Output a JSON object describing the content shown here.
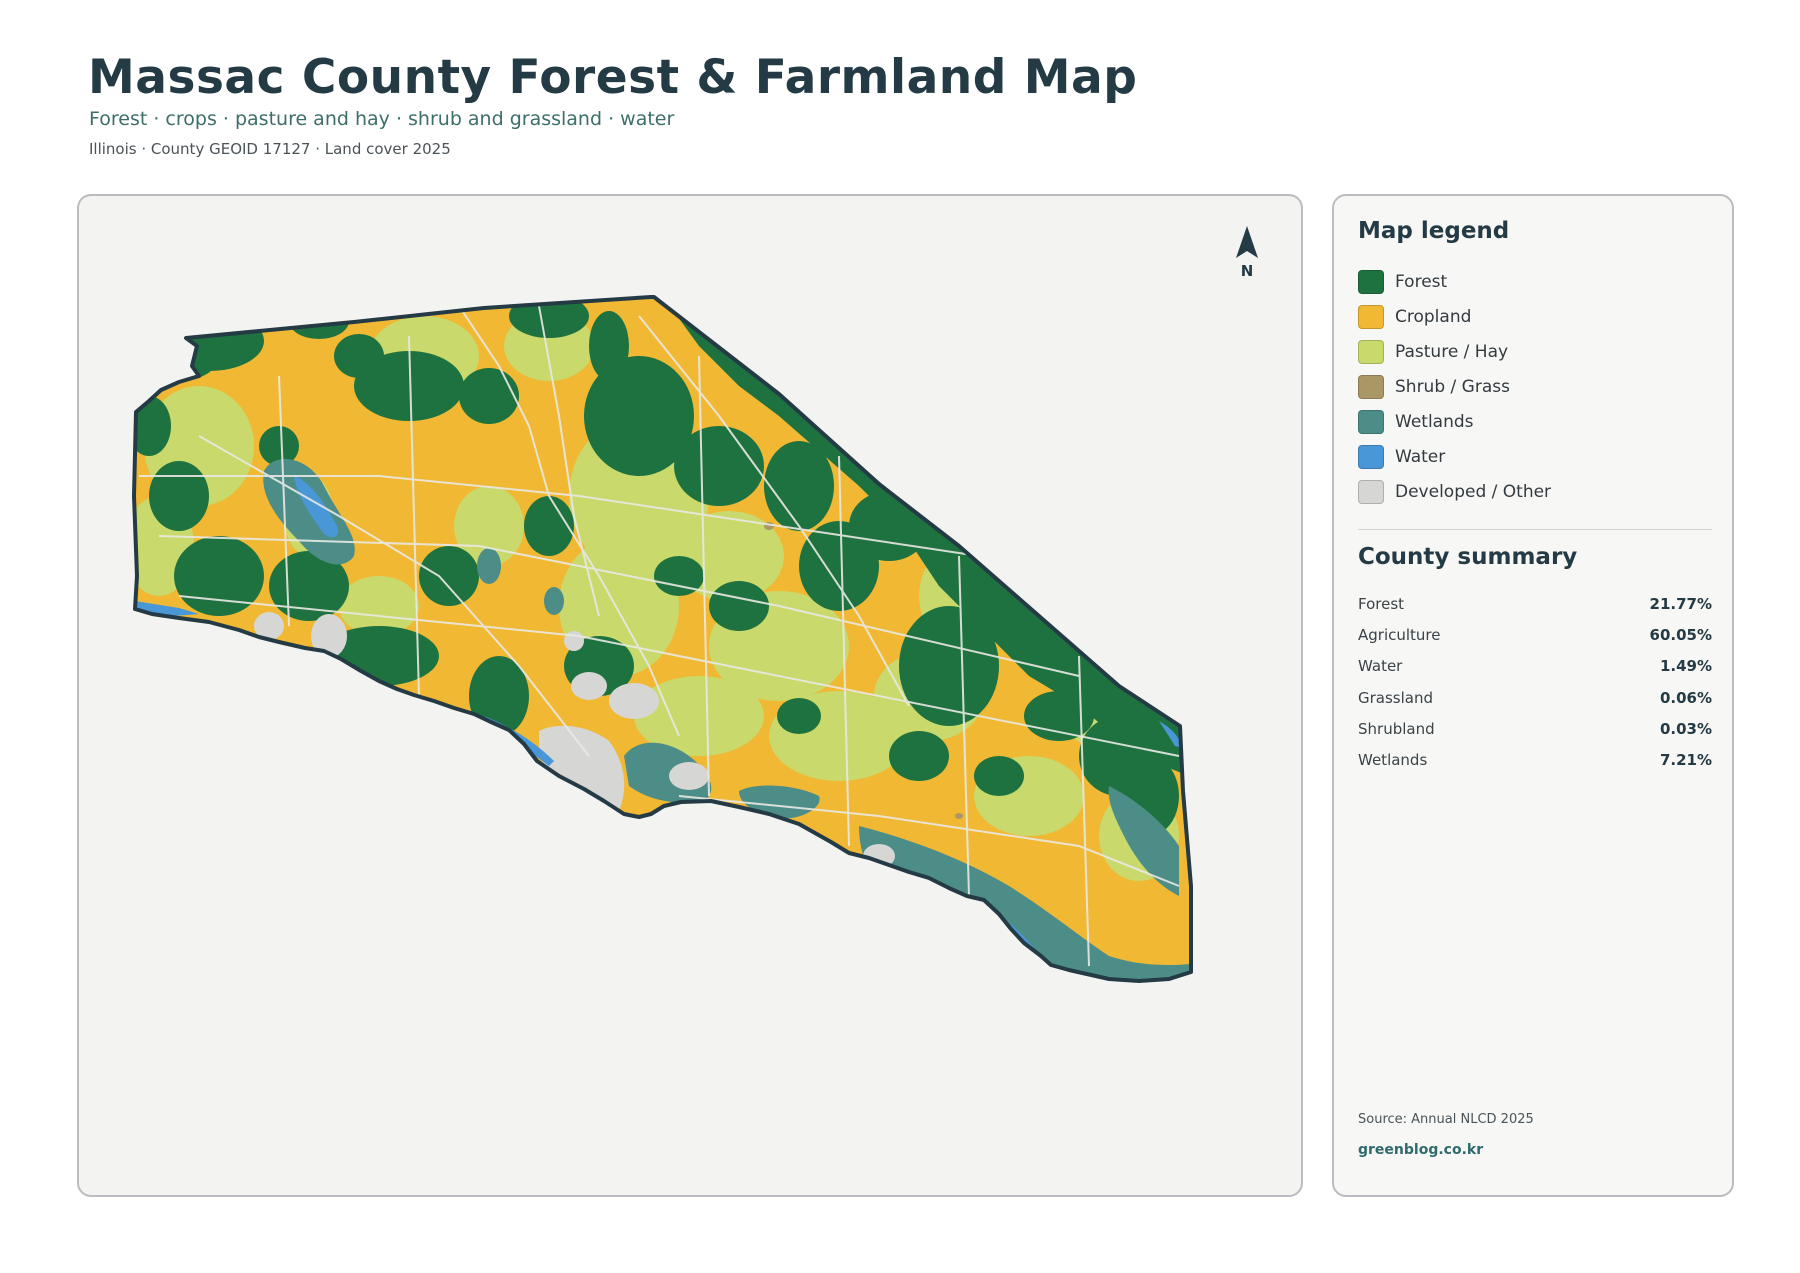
{
  "header": {
    "title": "Massac County Forest & Farmland Map",
    "subtitle": "Forest · crops · pasture and hay · shrub and grassland · water",
    "meta": "Illinois · County GEOID 17127 · Land cover 2025"
  },
  "map": {
    "north_label": "N",
    "background_color": "#f3f3f1",
    "outline_color": "#243a45",
    "road_color": "#e9e9e4"
  },
  "legend": {
    "title": "Map legend",
    "items": [
      {
        "label": "Forest",
        "color": "#1e7240"
      },
      {
        "label": "Cropland",
        "color": "#f1b833"
      },
      {
        "label": "Pasture / Hay",
        "color": "#c9d96b"
      },
      {
        "label": "Shrub / Grass",
        "color": "#a99765"
      },
      {
        "label": "Wetlands",
        "color": "#4d8d88"
      },
      {
        "label": "Water",
        "color": "#4a97d8"
      },
      {
        "label": "Developed / Other",
        "color": "#d6d6d4"
      }
    ]
  },
  "summary": {
    "title": "County summary",
    "rows": [
      {
        "name": "Forest",
        "value": "21.77%"
      },
      {
        "name": "Agriculture",
        "value": "60.05%"
      },
      {
        "name": "Water",
        "value": "1.49%"
      },
      {
        "name": "Grassland",
        "value": "0.06%"
      },
      {
        "name": "Shrubland",
        "value": "0.03%"
      },
      {
        "name": "Wetlands",
        "value": "7.21%"
      }
    ]
  },
  "footer": {
    "source": "Source: Annual NLCD 2025",
    "credit": "greenblog.co.kr"
  }
}
